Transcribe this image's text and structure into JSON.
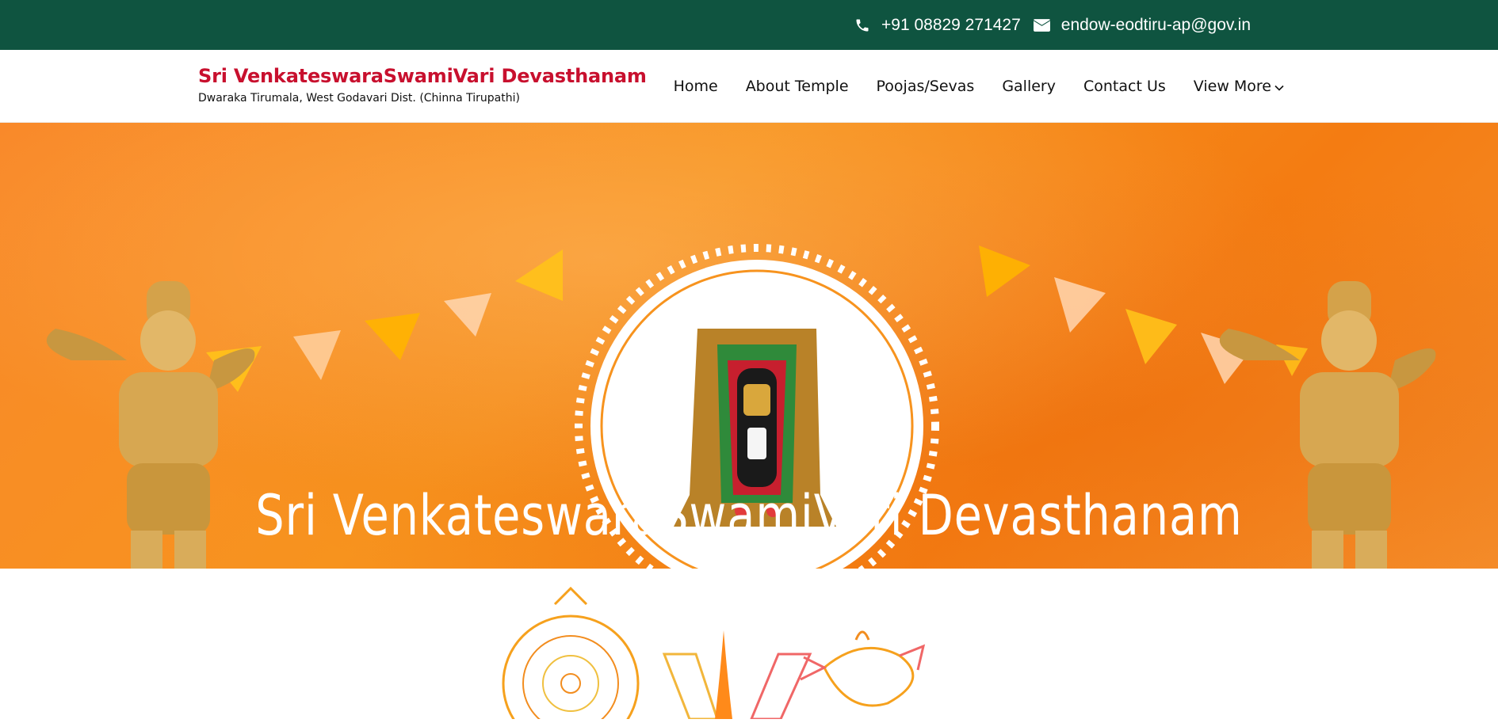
{
  "topbar": {
    "phone_icon": "phone-icon",
    "phone": "+91 08829 271427",
    "email_icon": "envelope-icon",
    "email": "endow-eodtiru-ap@gov.in"
  },
  "brand": {
    "title": "Sri VenkateswaraSwamiVari Devasthanam",
    "subtitle": "Dwaraka Tirumala, West Godavari Dist. (Chinna Tirupathi)"
  },
  "nav": {
    "items": [
      "Home",
      "About Temple",
      "Poojas/Sevas",
      "Gallery",
      "Contact Us",
      "View More"
    ],
    "more_icon": "chevron-down-icon"
  },
  "hero": {
    "title": "Sri VenkateswaraSwamiVari Devasthanam",
    "deity_image": "deity-image",
    "left_statue": "garuda-statue-left",
    "right_statue": "garuda-statue-right"
  },
  "symbols": [
    "chakra-icon",
    "namam-icon",
    "conch-icon"
  ],
  "colors": {
    "topbar": "#0f5440",
    "brand": "#c8102e",
    "hero_orange": "#f7931e"
  }
}
